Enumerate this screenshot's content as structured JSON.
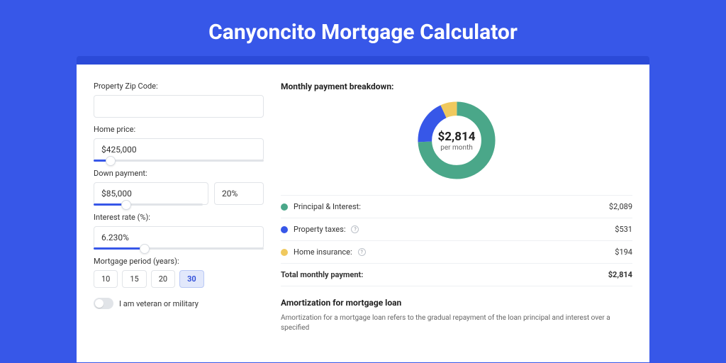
{
  "page": {
    "title": "Canyoncito Mortgage Calculator"
  },
  "form": {
    "zip_label": "Property Zip Code:",
    "zip_value": "",
    "home_price_label": "Home price:",
    "home_price_value": "$425,000",
    "down_payment_label": "Down payment:",
    "down_payment_value": "$85,000",
    "down_payment_pct": "20%",
    "interest_label": "Interest rate (%):",
    "interest_value": "6.230%",
    "period_label": "Mortgage period (years):",
    "periods": [
      "10",
      "15",
      "20",
      "30"
    ],
    "period_selected": "30",
    "veteran_label": "I am veteran or military"
  },
  "breakdown": {
    "title": "Monthly payment breakdown:",
    "center_amount": "$2,814",
    "center_caption": "per month",
    "items": [
      {
        "label": "Principal & Interest:",
        "value": "$2,089",
        "color": "green",
        "info": false
      },
      {
        "label": "Property taxes:",
        "value": "$531",
        "color": "blue",
        "info": true
      },
      {
        "label": "Home insurance:",
        "value": "$194",
        "color": "yellow",
        "info": true
      }
    ],
    "total_label": "Total monthly payment:",
    "total_value": "$2,814"
  },
  "amortization": {
    "title": "Amortization for mortgage loan",
    "text": "Amortization for a mortgage loan refers to the gradual repayment of the loan principal and interest over a specified"
  },
  "chart_data": {
    "type": "pie",
    "title": "Monthly payment breakdown",
    "series": [
      {
        "name": "Principal & Interest",
        "value": 2089,
        "color": "#4aa789"
      },
      {
        "name": "Property taxes",
        "value": 531,
        "color": "#3757e8"
      },
      {
        "name": "Home insurance",
        "value": 194,
        "color": "#f0c95e"
      }
    ],
    "total": 2814,
    "center_label": "$2,814 per month"
  }
}
